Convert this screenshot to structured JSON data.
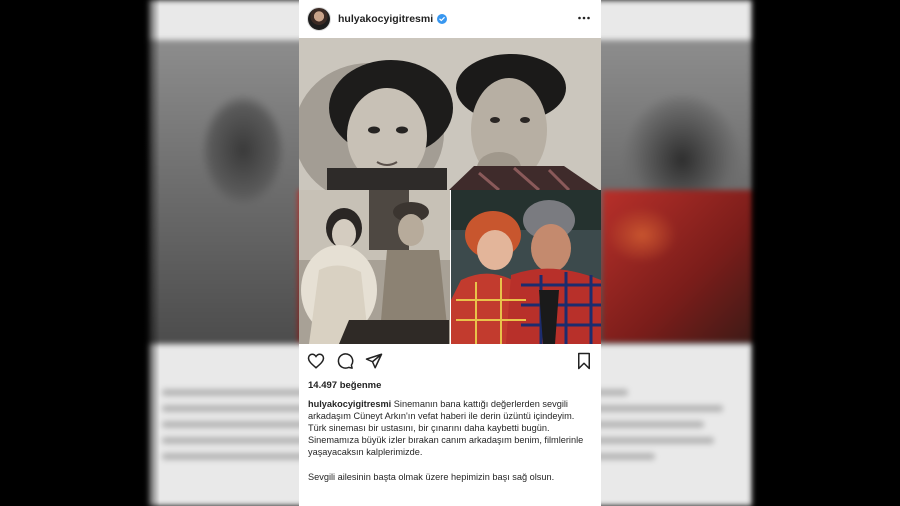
{
  "post": {
    "username": "hulyakocyigitresmi",
    "likes": "14.497 beğenme",
    "caption_user": "hulyakocyigitresmi",
    "caption_text": "Sinemanın bana kattığı değerlerden sevgili arkadaşım Cüneyt Arkın'ın vefat haberi ile derin üzüntü içindeyim. Türk sineması bir ustasını, bir çınarını daha kaybetti bugün. Sinemamıza büyük izler bırakan canım arkadaşım benim, filmlerinle yaşayacaksın kalplerimizde.",
    "caption_text_2": "Sevgili ailesinin başta olmak üzere hepimizin başı sağ olsun."
  },
  "icons": {
    "verified": "verified-badge-icon",
    "more": "more-options-icon",
    "like": "heart-icon",
    "comment": "comment-icon",
    "share": "send-icon",
    "save": "bookmark-icon"
  },
  "colors": {
    "background": "#000000",
    "card": "#ffffff",
    "text": "#262626",
    "verified": "#3897f0"
  }
}
